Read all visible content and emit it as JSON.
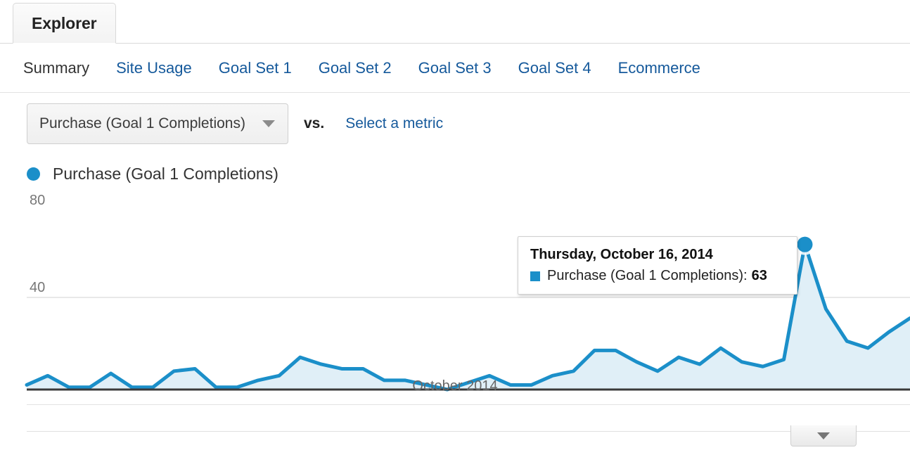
{
  "tab": {
    "label": "Explorer"
  },
  "subtabs": [
    {
      "label": "Summary",
      "active": true
    },
    {
      "label": "Site Usage",
      "active": false
    },
    {
      "label": "Goal Set 1",
      "active": false
    },
    {
      "label": "Goal Set 2",
      "active": false
    },
    {
      "label": "Goal Set 3",
      "active": false
    },
    {
      "label": "Goal Set 4",
      "active": false
    },
    {
      "label": "Ecommerce",
      "active": false
    }
  ],
  "metric_row": {
    "primary_metric": "Purchase (Goal 1 Completions)",
    "vs_label": "vs.",
    "secondary_metric_link": "Select a metric",
    "caret_icon": "chevron-down-icon"
  },
  "legend": {
    "series_label": "Purchase (Goal 1 Completions)",
    "dot_icon": "legend-dot-icon",
    "color": "#1b8fc9"
  },
  "tooltip": {
    "date": "Thursday, October 16, 2014",
    "metric_label": "Purchase (Goal 1 Completions):",
    "value": "63",
    "swatch_icon": "legend-square-icon"
  },
  "bottom_bar": {
    "collapse_icon": "chevron-down-icon"
  },
  "colors": {
    "line": "#1b8fc9",
    "fill": "#e0eff7",
    "link": "#15599b",
    "axis": "#3a3a3a",
    "grid": "#e8e8e8"
  },
  "chart_data": {
    "type": "area",
    "title": "Purchase (Goal 1 Completions)",
    "xlabel": "October 2014",
    "ylabel": "",
    "ylim": [
      0,
      80
    ],
    "yticks": [
      80,
      40
    ],
    "grid": true,
    "legend_position": "top-left",
    "series": [
      {
        "name": "Purchase (Goal 1 Completions)",
        "color": "#1b8fc9",
        "values": [
          2,
          6,
          1,
          1,
          7,
          1,
          1,
          8,
          9,
          1,
          1,
          4,
          6,
          14,
          11,
          9,
          9,
          4,
          4,
          2,
          0,
          3,
          6,
          2,
          2,
          6,
          8,
          17,
          17,
          12,
          8,
          14,
          11,
          18,
          12,
          10,
          13,
          63,
          35,
          21,
          18,
          25,
          31
        ]
      }
    ],
    "annotations": [
      {
        "type": "highlight-point",
        "index": 37,
        "value": 63,
        "label": "Thursday, October 16, 2014"
      }
    ]
  }
}
